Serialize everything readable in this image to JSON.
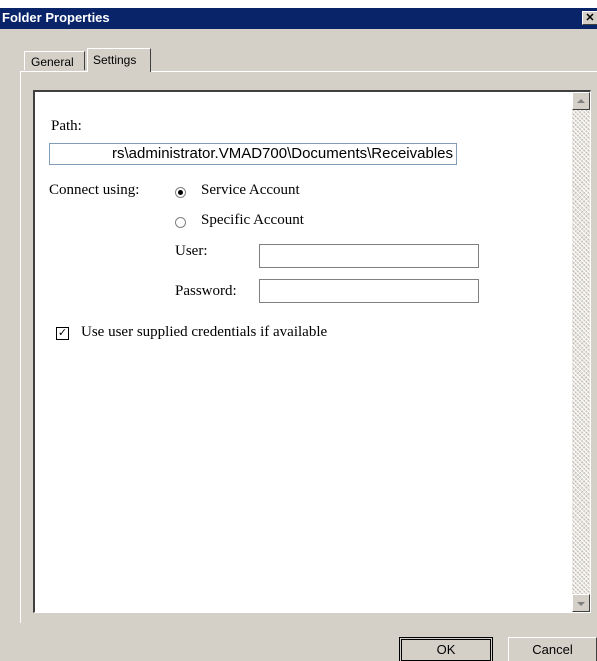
{
  "window": {
    "title": "Folder Properties",
    "close_glyph": "✕"
  },
  "tabs": [
    {
      "label": "General",
      "active": false
    },
    {
      "label": "Settings",
      "active": true
    }
  ],
  "settings": {
    "path_label": "Path:",
    "path_value": "rs\\administrator.VMAD700\\Documents\\Receivables",
    "connect_label": "Connect using:",
    "radio_service_label": "Service Account",
    "radio_specific_label": "Specific Account",
    "selected_connection": "Service Account",
    "user_label": "User:",
    "user_value": "",
    "password_label": "Password:",
    "password_value": "",
    "checkbox_label": "Use user supplied credentials if available",
    "checkbox_checked": true,
    "check_glyph": "✓"
  },
  "buttons": {
    "ok_label": "OK",
    "cancel_label": "Cancel"
  },
  "colors": {
    "titlebar": "#0a246a",
    "dialog_bg": "#d4d0c8",
    "content_bg": "#ffffff"
  }
}
